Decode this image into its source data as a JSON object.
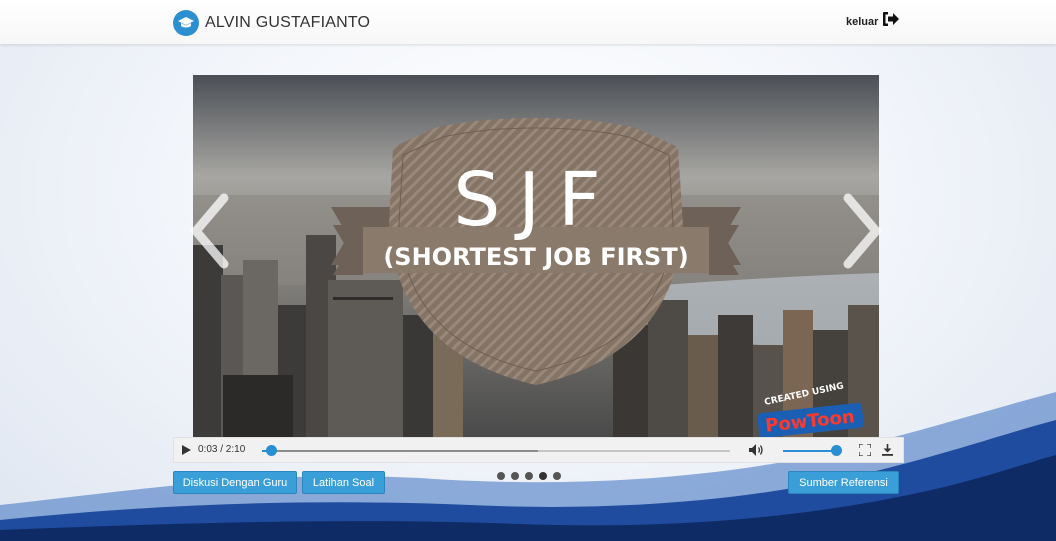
{
  "header": {
    "user_name": "ALVIN GUSTAFIANTO",
    "logout_label": "keluar"
  },
  "video": {
    "title_big": "SJF",
    "title_sub": "(SHORTEST JOB FIRST)",
    "watermark_top": "CREATED USING",
    "watermark_brand": "PowToon",
    "time": "0:03 / 2:10",
    "progress": 0.02,
    "buffered": 0.59,
    "volume": 1.0
  },
  "buttons": {
    "discuss": "Diskusi Dengan Guru",
    "exercise": "Latihan Soal",
    "reference": "Sumber Referensi"
  },
  "slides": {
    "count": 5,
    "active_index": 3
  },
  "colors": {
    "accent": "#3a9fd8",
    "wave_dark": "#0e2b66",
    "wave_mid": "#2b5fb0"
  }
}
